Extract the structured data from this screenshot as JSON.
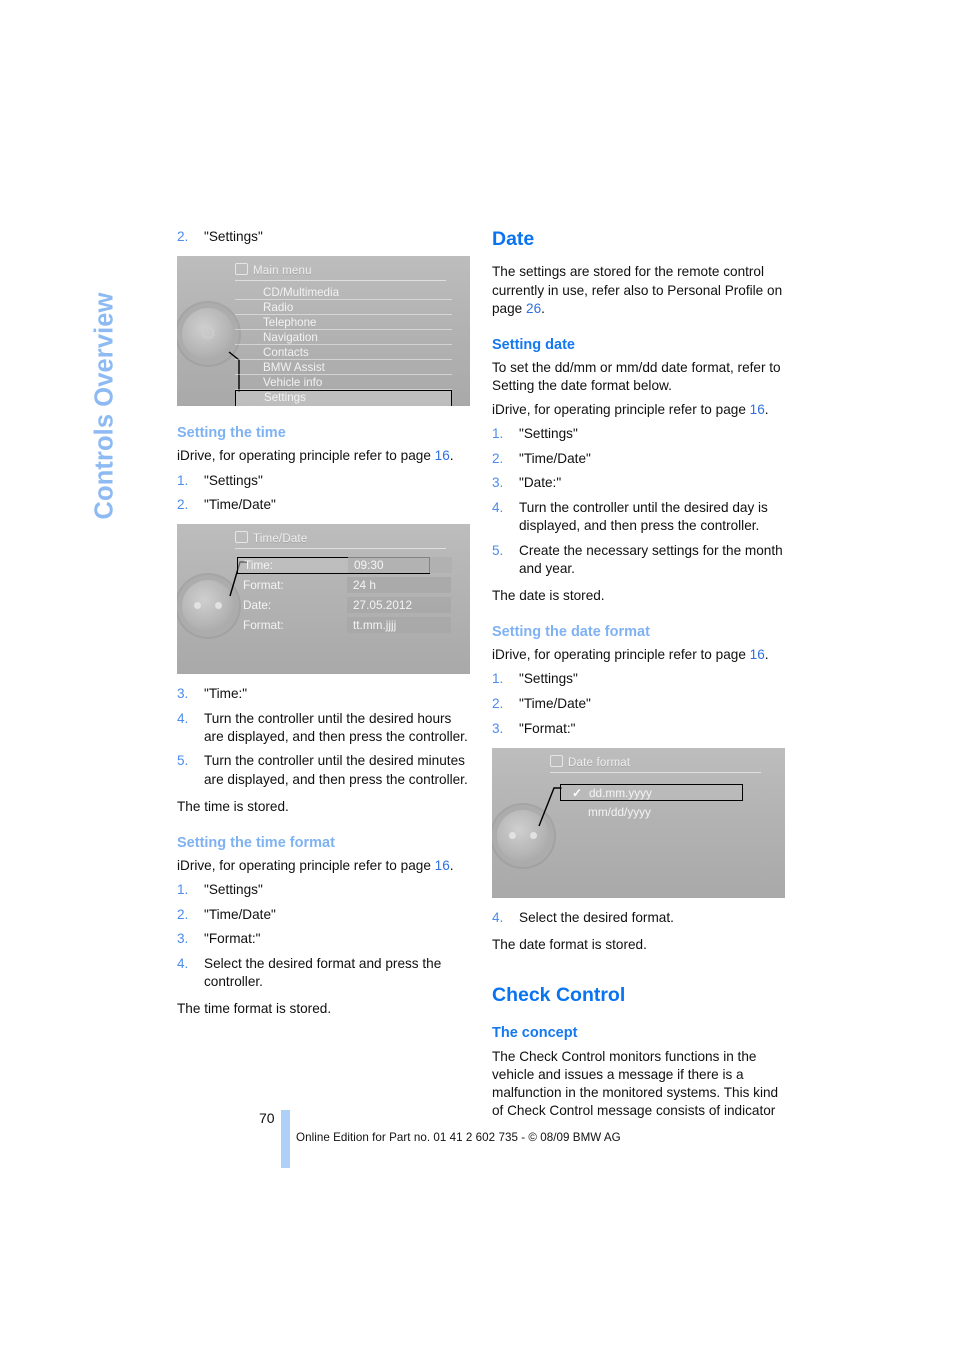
{
  "chapter_tab": "Controls Overview",
  "left_column": {
    "lead_step": {
      "num": "2.",
      "text": "\"Settings\""
    },
    "main_menu_screen": {
      "title": "Main menu",
      "title_icon": "menu-icon",
      "items": [
        "CD/Multimedia",
        "Radio",
        "Telephone",
        "Navigation",
        "Contacts",
        "BMW Assist",
        "Vehicle info",
        "Settings"
      ],
      "selected_item": "Settings"
    },
    "setting_the_time": {
      "heading": "Setting the time",
      "intro_before": "iDrive, for operating principle refer to page ",
      "intro_page": "16",
      "intro_after": ".",
      "steps": [
        {
          "num": "1.",
          "text": "\"Settings\""
        },
        {
          "num": "2.",
          "text": "\"Time/Date\""
        }
      ]
    },
    "time_date_screen": {
      "title": "Time/Date",
      "title_icon": "clock-icon",
      "rows": [
        {
          "key": "Time:",
          "value": "09:30",
          "selected": true
        },
        {
          "key": "Format:",
          "value": "24 h",
          "selected": false
        },
        {
          "key": "Date:",
          "value": "27.05.2012",
          "selected": false
        },
        {
          "key": "Format:",
          "value": "tt.mm.jjjj",
          "selected": false
        }
      ]
    },
    "time_steps_after": [
      {
        "num": "3.",
        "text": "\"Time:\""
      },
      {
        "num": "4.",
        "text": "Turn the controller until the desired hours are displayed, and then press the controller."
      },
      {
        "num": "5.",
        "text": "Turn the controller until the desired minutes are displayed, and then press the controller."
      }
    ],
    "time_stored": "The time is stored.",
    "setting_the_time_format": {
      "heading": "Setting the time format",
      "intro_before": "iDrive, for operating principle refer to page ",
      "intro_page": "16",
      "intro_after": ".",
      "steps": [
        {
          "num": "1.",
          "text": "\"Settings\""
        },
        {
          "num": "2.",
          "text": "\"Time/Date\""
        },
        {
          "num": "3.",
          "text": "\"Format:\""
        },
        {
          "num": "4.",
          "text": "Select the desired format and press the controller."
        }
      ],
      "closing": "The time format is stored."
    }
  },
  "right_column": {
    "date_section": {
      "heading": "Date",
      "intro_before": "The settings are stored for the remote control currently in use, refer also to Personal Profile on page ",
      "intro_page": "26",
      "intro_after": "."
    },
    "setting_date": {
      "heading": "Setting date",
      "note": "To set the dd/mm or mm/dd date format, refer to Setting the date format below.",
      "intro_before": "iDrive, for operating principle refer to page ",
      "intro_page": "16",
      "intro_after": ".",
      "steps": [
        {
          "num": "1.",
          "text": "\"Settings\""
        },
        {
          "num": "2.",
          "text": "\"Time/Date\""
        },
        {
          "num": "3.",
          "text": "\"Date:\""
        },
        {
          "num": "4.",
          "text": "Turn the controller until the desired day is displayed, and then press the controller."
        },
        {
          "num": "5.",
          "text": "Create the necessary settings for the month and year."
        }
      ],
      "closing": "The date is stored."
    },
    "setting_date_format": {
      "heading": "Setting the date format",
      "intro_before": "iDrive, for operating principle refer to page ",
      "intro_page": "16",
      "intro_after": ".",
      "steps": [
        {
          "num": "1.",
          "text": "\"Settings\""
        },
        {
          "num": "2.",
          "text": "\"Time/Date\""
        },
        {
          "num": "3.",
          "text": "\"Format:\""
        }
      ],
      "after_step": {
        "num": "4.",
        "text": "Select the desired format."
      },
      "closing": "The date format is stored."
    },
    "date_format_screen": {
      "title": "Date format",
      "title_icon": "calendar-icon",
      "options": [
        {
          "label": "dd.mm.yyyy",
          "checked": true,
          "selected": true
        },
        {
          "label": "mm/dd/yyyy",
          "checked": false,
          "selected": false
        }
      ],
      "check_glyph": "✓"
    },
    "check_control": {
      "heading": "Check Control",
      "sub_heading": "The concept",
      "body": "The Check Control monitors functions in the vehicle and issues a message if there is a malfunction in the monitored systems. This kind of Check Control message consists of indicator"
    }
  },
  "footer": {
    "page_number": "70",
    "imprint": "Online Edition for Part no. 01 41 2 602 735 - © 08/09 BMW AG"
  },
  "colors": {
    "heading_blue": "#0A74F0",
    "subheading_blue": "#7FB2F2",
    "tab_blue": "#8DBAF2",
    "footer_bar_blue": "#AED0F7",
    "link_blue": "#2F6FE0"
  }
}
